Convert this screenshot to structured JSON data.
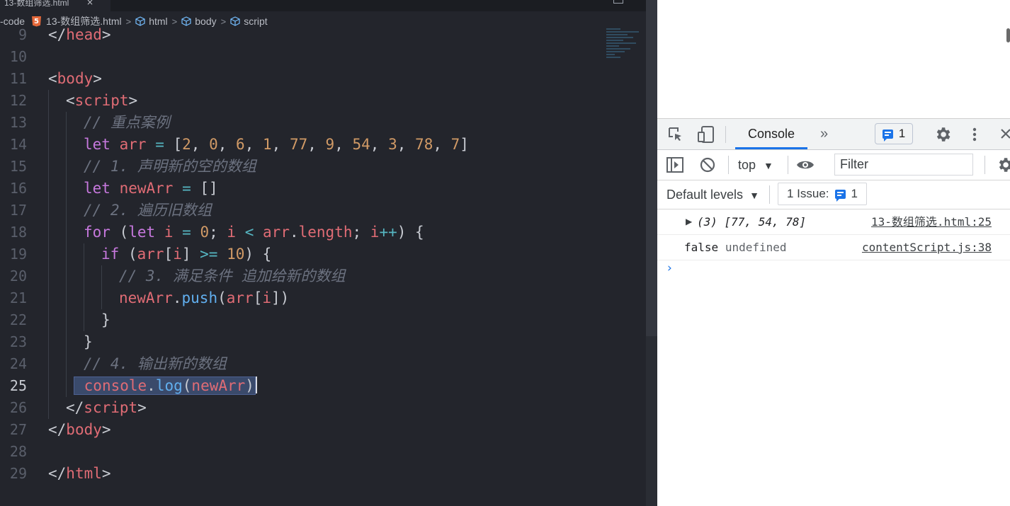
{
  "editor": {
    "tab_title": "13-数组筛选.html",
    "tab_close": "×",
    "breadcrumb": {
      "folder": "-code",
      "file": "13-数组筛选.html",
      "html": "html",
      "body": "body",
      "script": "script",
      "separator": ">"
    },
    "current_line": 25
  },
  "devtools": {
    "tab_console": "Console",
    "more_tabs": "»",
    "issues_badge_count": "1",
    "context_select": "top",
    "filter_placeholder": "Filter",
    "default_levels": "Default levels",
    "issue_counter_label": "1 Issue:",
    "issue_counter_count": "1",
    "logs": [
      {
        "message": "(3) [77, 54, 78]",
        "source": "13-数组筛选.html:25"
      },
      {
        "message_value": "false",
        "message_rest": "undefined",
        "source": "contentScript.js:38"
      }
    ],
    "prompt": "›"
  },
  "colors": {
    "accent": "#1a73e8",
    "keyword": "#c678dd",
    "variable": "#e06c75",
    "number": "#d19a66",
    "function": "#61afef",
    "comment": "#6c7280"
  }
}
